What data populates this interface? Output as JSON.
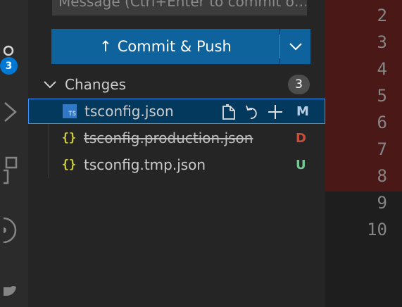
{
  "activity_bar": {
    "scm_badge": "3",
    "icons": [
      "source-control-icon",
      "run-debug-icon",
      "extensions-icon",
      "remote-explorer-icon",
      "docker-icon"
    ]
  },
  "scm": {
    "message_placeholder": "Message (Ctrl+Enter to commit o…",
    "commit_label": "Commit & Push",
    "commit_arrow": "↑",
    "changes_label": "Changes",
    "changes_count": "3",
    "files": [
      {
        "name": "tsconfig.json",
        "status": "M",
        "status_color": "#b8cfe3",
        "icon": "typescript-file-icon",
        "icon_text": "TS",
        "selected": true
      },
      {
        "name": "tsconfig.production.json",
        "status": "D",
        "status_color": "#c74e39",
        "icon": "json-file-icon",
        "icon_text": "{}",
        "deleted": true
      },
      {
        "name": "tsconfig.tmp.json",
        "status": "U",
        "status_color": "#73c991",
        "icon": "json-file-icon",
        "icon_text": "{}"
      }
    ]
  },
  "editor": {
    "line_numbers": [
      "2",
      "3",
      "4",
      "5",
      "6",
      "7",
      "8",
      "9",
      "10"
    ],
    "removed_bg": "#4b1818"
  }
}
